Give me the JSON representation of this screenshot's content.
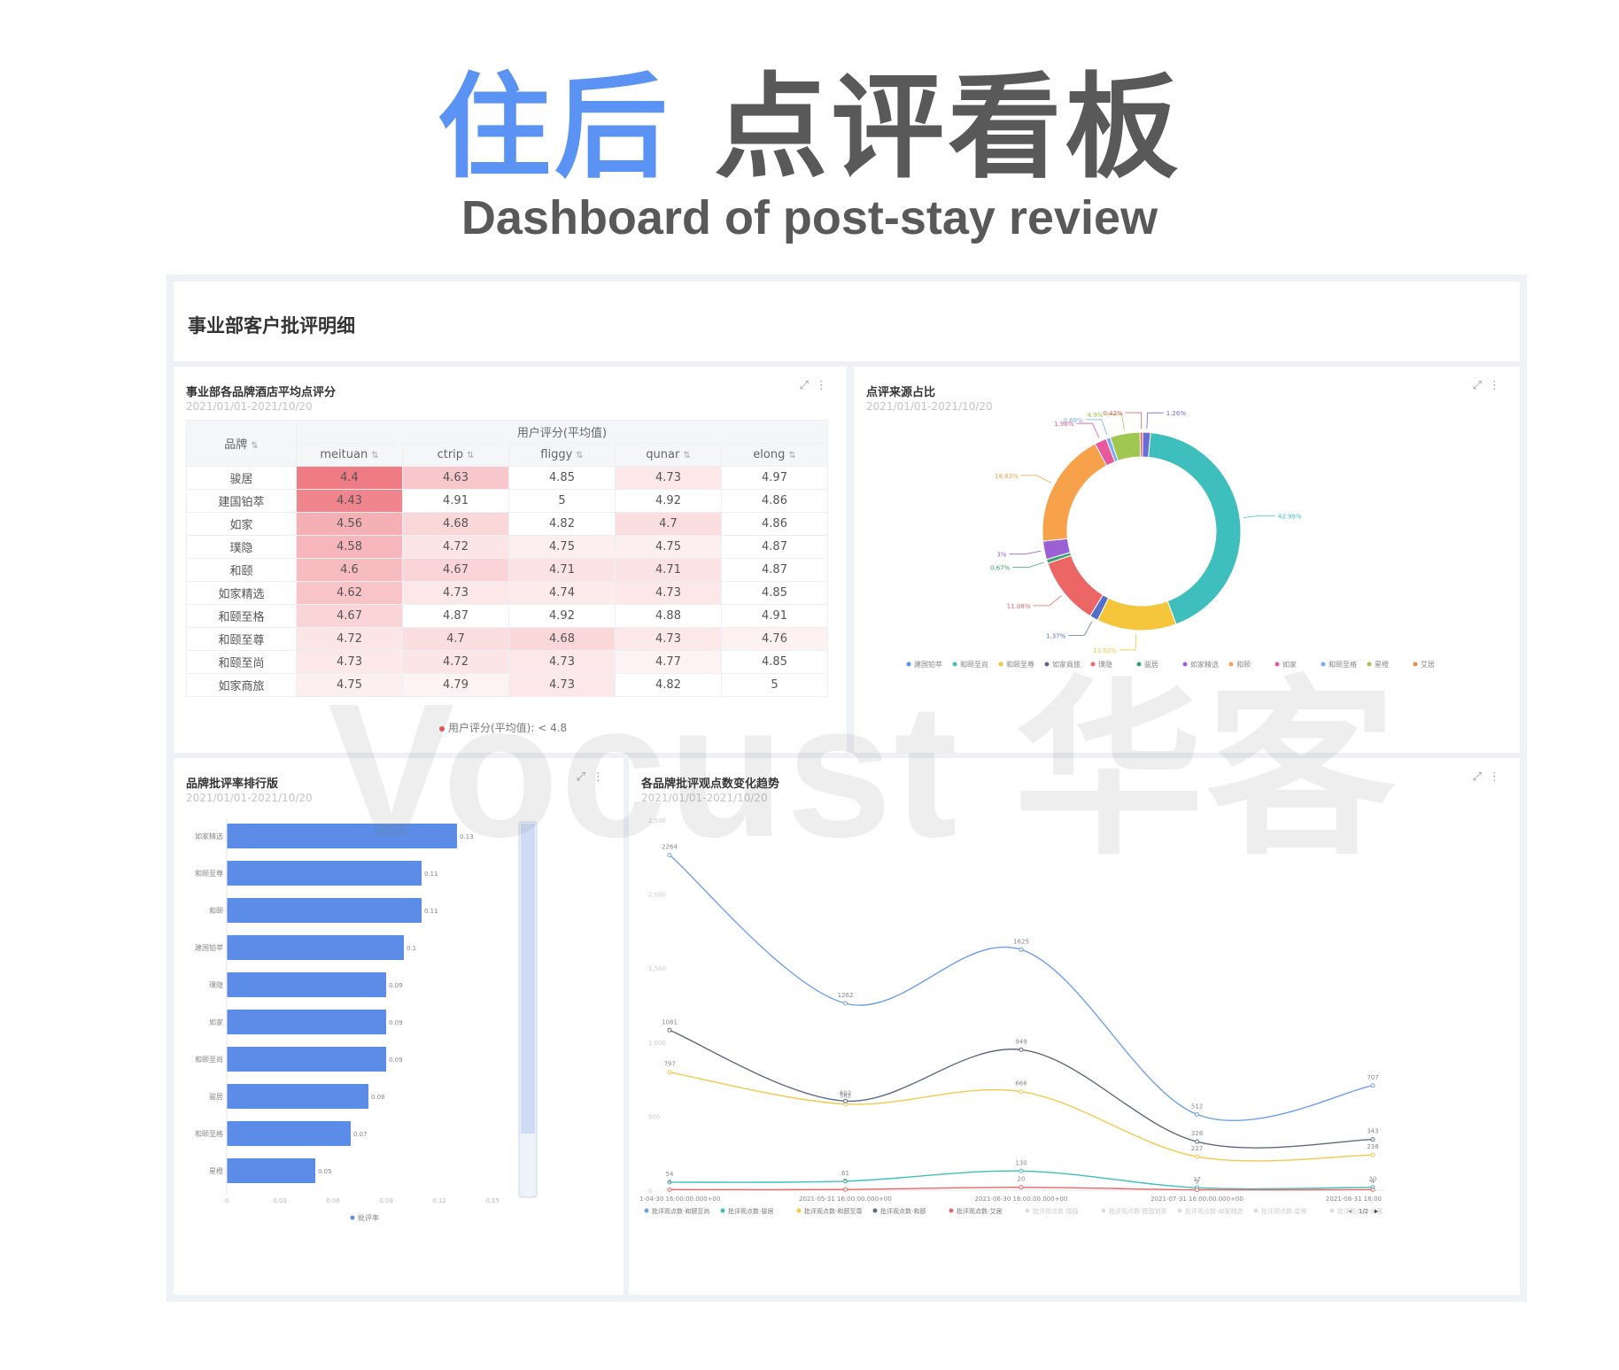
{
  "hero": {
    "title_blue": "住后",
    "title_gray": "点评看板",
    "subtitle": "Dashboard of post-stay review"
  },
  "section": {
    "title": "事业部客户批评明细"
  },
  "watermark": "Vocust 华客",
  "card1": {
    "title": "事业部各品牌酒店平均点评分",
    "date": "2021/01/01-2021/10/20",
    "brand_header": "品牌",
    "group_header": "用户评分(平均值)",
    "columns": [
      "meituan",
      "ctrip",
      "fliggy",
      "qunar",
      "elong"
    ],
    "rows": [
      {
        "brand": "骏居",
        "values": [
          "4.4",
          "4.63",
          "4.85",
          "4.73",
          "4.97"
        ]
      },
      {
        "brand": "建国铂萃",
        "values": [
          "4.43",
          "4.91",
          "5",
          "4.92",
          "4.86"
        ]
      },
      {
        "brand": "如家",
        "values": [
          "4.56",
          "4.68",
          "4.82",
          "4.7",
          "4.86"
        ]
      },
      {
        "brand": "璞隐",
        "values": [
          "4.58",
          "4.72",
          "4.75",
          "4.75",
          "4.87"
        ]
      },
      {
        "brand": "和颐",
        "values": [
          "4.6",
          "4.67",
          "4.71",
          "4.71",
          "4.87"
        ]
      },
      {
        "brand": "如家精选",
        "values": [
          "4.62",
          "4.73",
          "4.74",
          "4.73",
          "4.85"
        ]
      },
      {
        "brand": "和颐至格",
        "values": [
          "4.67",
          "4.87",
          "4.92",
          "4.88",
          "4.91"
        ]
      },
      {
        "brand": "和颐至尊",
        "values": [
          "4.72",
          "4.7",
          "4.68",
          "4.73",
          "4.76"
        ]
      },
      {
        "brand": "和颐至尚",
        "values": [
          "4.73",
          "4.72",
          "4.73",
          "4.77",
          "4.85"
        ]
      },
      {
        "brand": "如家商旅",
        "values": [
          "4.75",
          "4.79",
          "4.73",
          "4.82",
          "5"
        ]
      }
    ],
    "legend": "用户评分(平均值): < 4.8",
    "highlight_color": "#f08c8f"
  },
  "card2": {
    "title": "点评来源占比",
    "date": "2021/01/01-2021/10/20",
    "chart_data": {
      "type": "pie",
      "slices": [
        {
          "value": 42.99,
          "label": "42.99%",
          "color": "#3ebfbd"
        },
        {
          "value": 13.02,
          "label": "13.02%",
          "color": "#f5c63b"
        },
        {
          "value": 1.37,
          "label": "1.37%",
          "color": "#5470c6"
        },
        {
          "value": 11.08,
          "label": "11.08%",
          "color": "#ec6666"
        },
        {
          "value": 0.67,
          "label": "0.67%",
          "color": "#3ba272"
        },
        {
          "value": 3,
          "label": "3%",
          "color": "#9a60d4"
        },
        {
          "value": 18.83,
          "label": "18.83%",
          "color": "#f7a14a"
        },
        {
          "value": 1.96,
          "label": "1.96%",
          "color": "#e8589e"
        },
        {
          "value": 0.69,
          "label": "0.69%",
          "color": "#7aa9f5"
        },
        {
          "value": 4.9,
          "label": "4.9%",
          "color": "#a0c850"
        },
        {
          "value": 0.42,
          "label": "0.42%",
          "color": "#e05a5a"
        },
        {
          "value": 1.26,
          "label": "1.26%",
          "color": "#6b6bd8"
        }
      ],
      "legend": [
        "建国铂萃",
        "和颐至尚",
        "和颐至尊",
        "如家商旅",
        "璞隐",
        "骏居",
        "如家精选",
        "和颐",
        "如家",
        "和颐至格",
        "星橙",
        "艾居"
      ],
      "legend_colors": [
        "#5b8ff9",
        "#3ebfbd",
        "#f5c63b",
        "#5d6b84",
        "#ec6666",
        "#3ba272",
        "#9a60d4",
        "#f7a14a",
        "#e8589e",
        "#7aa9f5",
        "#a0c850",
        "#f08c3c"
      ]
    }
  },
  "card3": {
    "title": "品牌批评率排行版",
    "date": "2021/01/01-2021/10/20",
    "chart_data": {
      "type": "bar",
      "orientation": "horizontal",
      "categories": [
        "如家精选",
        "和颐至尊",
        "和颐",
        "建国铂萃",
        "璞隐",
        "如家",
        "和颐至尚",
        "骏居",
        "和颐至格",
        "星橙"
      ],
      "values": [
        0.13,
        0.11,
        0.11,
        0.1,
        0.09,
        0.09,
        0.09,
        0.08,
        0.07,
        0.05
      ],
      "value_labels": [
        "0.13",
        "0.11",
        "0.11",
        "0.1",
        "0.09",
        "0.09",
        "0.09",
        "0.08",
        "0.07",
        "0.05"
      ],
      "xlim": [
        0,
        0.15
      ],
      "x_ticks": [
        "0",
        "0.03",
        "0.06",
        "0.09",
        "0.12",
        "0.15"
      ],
      "legend": "批评率",
      "color": "#5b8de8"
    }
  },
  "card4": {
    "title": "各品牌批评观点数变化趋势",
    "date": "2021/01/01-2021/10/20",
    "chart_data": {
      "type": "line",
      "x": [
        "2021-04-30 16:00:00.000+00",
        "2021-05-31 16:00:00.000+00",
        "2021-06-30 16:00:00.000+00",
        "2021-07-31 16:00:00.000+00",
        "2021-08-31 16:00:00.000+00"
      ],
      "x_tick_labels": [
        "1-04-30 16:00:00.000+00",
        "2021-05-31 16:00:00.000+00",
        "2021-06-30 16:00:00.000+00",
        "2021-07-31 16:00:00.000+00",
        "2021-08-31 16:00"
      ],
      "ylim": [
        0,
        2500
      ],
      "y_ticks": [
        "0",
        "500",
        "1,000",
        "1,500",
        "2,000",
        "2,500"
      ],
      "series": [
        {
          "name": "批评观点数-和颐至尚",
          "color": "#6fa0ee",
          "values": [
            2264,
            1262,
            1625,
            512,
            707
          ]
        },
        {
          "name": "批评观点数-骏居",
          "color": "#3ebfbd",
          "values": [
            54,
            61,
            130,
            17,
            20
          ]
        },
        {
          "name": "批评观点数-和颐至尊",
          "color": "#f2c94c",
          "values": [
            797,
            582,
            666,
            227,
            238
          ]
        },
        {
          "name": "批评观点数-和颐",
          "color": "#5d6b84",
          "values": [
            1081,
            602,
            949,
            328,
            343
          ]
        },
        {
          "name": "批评观点数-艾居",
          "color": "#ec6666",
          "values": [
            4,
            5,
            20,
            3,
            4
          ]
        }
      ],
      "legend_more": [
        "批评观点数-璞隐",
        "批评观点数-建国铂萃",
        "批评观点数-如家精选",
        "批评观点数-星橙",
        "批评观点数-如家"
      ],
      "pager": "1/2"
    }
  }
}
